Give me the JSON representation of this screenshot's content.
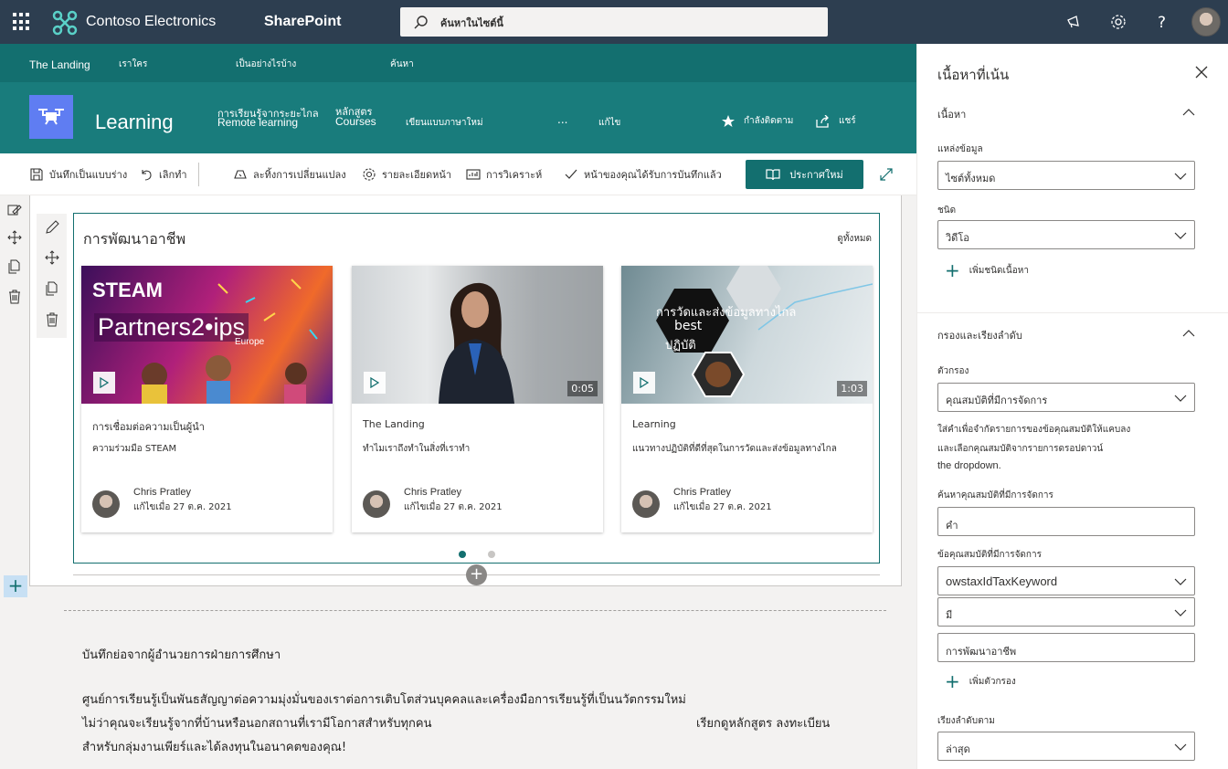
{
  "suite_bar": {
    "org_name": "Contoso Electronics",
    "app_name": "SharePoint",
    "search_placeholder": "ค้นหาในไซต์นี้",
    "icons": [
      "waffle-icon",
      "megaphone-icon",
      "gear-icon",
      "help-icon",
      "avatar"
    ]
  },
  "hub_nav": {
    "items": [
      "The Landing",
      "เราใคร",
      "เป็นอย่างไรบ้าง",
      "ค้นหา"
    ]
  },
  "site_header": {
    "title": "Learning",
    "nav": [
      {
        "line1": "การเรียนรู้จากระยะไกล",
        "line2": "Remote learning"
      },
      {
        "line1": "หลักสูตร",
        "line2": "Courses"
      },
      {
        "line1": "เขียนแบบภาษาใหม่",
        "line2": ""
      },
      {
        "line1": "...",
        "line2": ""
      },
      {
        "line1": "แก้ไข",
        "line2": ""
      }
    ],
    "follow_label": "กำลังติดตาม",
    "share_label": "แชร์"
  },
  "command_bar": {
    "save_draft": "บันทึกเป็นแบบร่าง",
    "undo": "เลิกทำ",
    "discard": "ละทิ้งการเปลี่ยนแปลง",
    "page_details": "รายละเอียดหน้า",
    "analytics": "การวิเคราะห์",
    "saved_status": "หน้าของคุณได้รับการบันทึกแล้ว",
    "republish": "ประกาศใหม่"
  },
  "webpart": {
    "title": "การพัฒนาอาชีพ",
    "see_all": "ดูทั้งหมด",
    "cards": [
      {
        "category": "การเชื่อมต่อความเป็นผู้นำ",
        "title": "ความร่วมมือ STEAM",
        "author": "Chris Pratley",
        "date": "แก้ไขเมื่อ 27 ต.ค. 2021",
        "image_text_1": "STEAM",
        "image_text_2": "Partners2•ips",
        "image_text_3": "Europe",
        "duration": ""
      },
      {
        "category": "The Landing",
        "title": "ทำไมเราถึงทำในสิ่งที่เราทำ",
        "author": "Chris Pratley",
        "date": "แก้ไขเมื่อ 27 ต.ค. 2021",
        "duration": "0:05"
      },
      {
        "category": "Learning",
        "title": "แนวทางปฏิบัติที่ดีที่สุดในการวัดและส่งข้อมูลทางไกล",
        "author": "Chris Pratley",
        "date": "แก้ไขเมื่อ 27 ต.ค. 2021",
        "image_text_1": "การวัดและส่งข้อมูลทางไกล",
        "image_text_2": "best",
        "image_text_3": "ปฏิบัติ",
        "duration": "1:03"
      }
    ],
    "carousel_pages": 2,
    "carousel_active": 1
  },
  "text_section": {
    "heading": "บันทึกย่อจากผู้อำนวยการฝ่ายการศึกษา",
    "line1": "ศูนย์การเรียนรู้เป็นพันธสัญญาต่อความมุ่งมั่นของเราต่อการเติบโตส่วนบุคคลและเครื่องมือการเรียนรู้ที่เป็นนวัตกรรมใหม่",
    "line2a": "ไม่ว่าคุณจะเรียนรู้จากที่บ้านหรือนอกสถานที่เรามีโอกาสสำหรับทุกคน",
    "line2b": "เรียกดูหลักสูตร ลงทะเบียน",
    "line3": "สำหรับกลุ่มงานเพียร์และได้ลงทุนในอนาคตของคุณ!"
  },
  "panel": {
    "title": "เนื้อหาที่เน้น",
    "content_section": "เนื้อหา",
    "source_label": "แหล่งข้อมูล",
    "source_value": "ไซต์ทั้งหมด",
    "type_label": "ชนิด",
    "type_value": "วิดีโอ",
    "add_content_type": "เพิ่มชนิดเนื้อหา",
    "filter_section": "กรองและเรียงลำดับ",
    "filter_label": "ตัวกรอง",
    "filter_value": "คุณสมบัติที่มีการจัดการ",
    "help_line1": "ใส่คำเพื่อจำกัดรายการของข้อคุณสมบัติให้แคบลง",
    "help_line2": "และเลือกคุณสมบัติจากรายการดรอปดาวน์",
    "help_line3": "the dropdown.",
    "search_prop_label": "ค้นหาคุณสมบัติที่มีการจัดการ",
    "search_prop_value": "คำ",
    "managed_prop_label": "ข้อคุณสมบัติที่มีการจัดการ",
    "managed_prop_value": "owstaxIdTaxKeyword",
    "operator_value": "มี",
    "keyword_value": "การพัฒนาอาชีพ",
    "add_filter": "เพิ่มตัวกรอง",
    "sort_label": "เรียงลำดับตาม",
    "sort_value": "ล่าสุด"
  },
  "colors": {
    "suite_bar": "#2d3e50",
    "hub_nav": "#136f6f",
    "site_header": "#197c7c",
    "accent": "#136f6f",
    "site_logo": "#5f7df2"
  }
}
